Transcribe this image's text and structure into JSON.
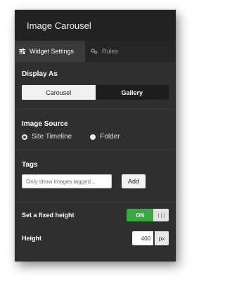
{
  "window": {
    "title": "Image Carousel"
  },
  "tabs": [
    {
      "label": "Widget Settings",
      "icon": "sliders-icon",
      "active": true
    },
    {
      "label": "Rules",
      "icon": "gears-icon",
      "active": false
    }
  ],
  "display_as": {
    "heading": "Display As",
    "options": [
      "Carousel",
      "Gallery"
    ],
    "selected": "Carousel"
  },
  "image_source": {
    "heading": "Image Source",
    "options": [
      "Site Timeline",
      "Folder"
    ],
    "selected": "Site Timeline"
  },
  "tags": {
    "heading": "Tags",
    "placeholder": "Only show images tagged...",
    "add_label": "Add"
  },
  "fixed_height": {
    "label": "Set a fixed height",
    "state": "ON",
    "on_color": "#3aa843"
  },
  "height": {
    "label": "Height",
    "value": "400",
    "unit": "px"
  }
}
